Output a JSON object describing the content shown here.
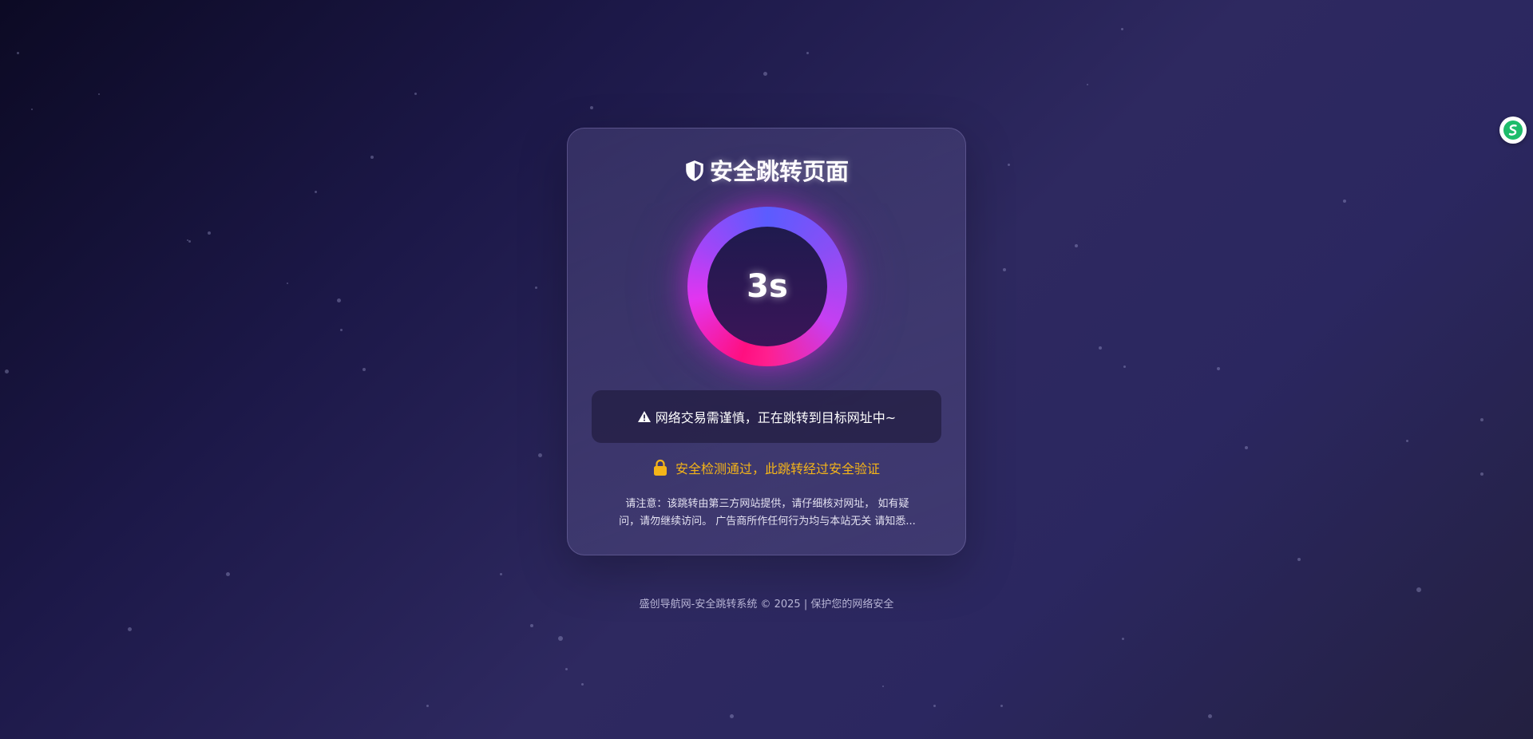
{
  "page": {
    "title": "安全跳转页面"
  },
  "countdown": {
    "value": 3,
    "label": "3s"
  },
  "notice": {
    "text": "网络交易需谨慎，正在跳转到目标网址中~"
  },
  "security": {
    "text": "安全检测通过，此跳转经过安全验证"
  },
  "disclaimer": {
    "line1": "请注意：该跳转由第三方网站提供，请仔细核对网址， 如有疑",
    "line2": "问，请勿继续访问。 广告商所作任何行为均与本站无关 请知悉..."
  },
  "footer": {
    "text": "盛创导航网-安全跳转系统 © 2025 | 保护您的网络安全"
  },
  "icons": {
    "title": "shield-icon",
    "notice": "warning-icon",
    "security": "lock-icon",
    "floating": "extension-logo-icon"
  },
  "colors": {
    "accent_gold": "#f5b418",
    "ring_blue": "#5b5cff",
    "ring_magenta": "#e235f0",
    "ring_pink": "#ff0f80",
    "floating_green": "#1ebc6b"
  }
}
